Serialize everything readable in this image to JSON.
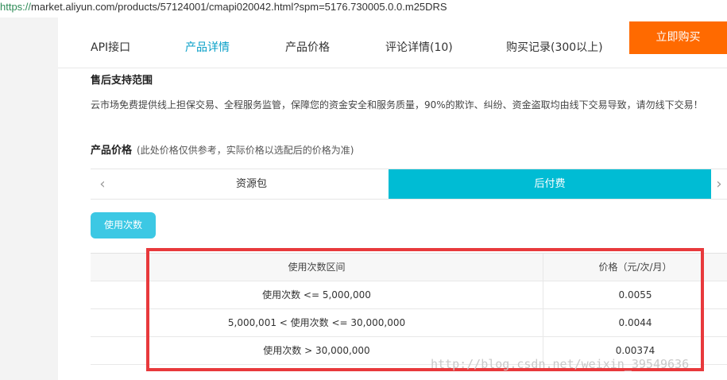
{
  "browser": {
    "url_scheme": "https://",
    "url_rest": "market.aliyun.com/products/57124001/cmapi020042.html?spm=5176.730005.0.0.m25DRS"
  },
  "nav": {
    "tabs": [
      {
        "label": "API接口",
        "active": false
      },
      {
        "label": "产品详情",
        "active": true
      },
      {
        "label": "产品价格",
        "active": false
      },
      {
        "label": "评论详情(10)",
        "active": false
      },
      {
        "label": "购买记录(300以上)",
        "active": false
      }
    ],
    "buy_button": "立即购买"
  },
  "support": {
    "title": "售后支持范围",
    "text": "云市场免费提供线上担保交易、全程服务监管，保障您的资金安全和服务质量，90%的欺诈、纠纷、资金盗取均由线下交易导致，请勿线下交易！"
  },
  "pricing": {
    "title": "产品价格",
    "note": "(此处价格仅供参考，实际价格以选配后的价格为准)",
    "prev_arrow": "‹",
    "next_arrow": "›",
    "tabs": [
      {
        "label": "资源包",
        "active": false
      },
      {
        "label": "后付费",
        "active": true
      }
    ],
    "spec_pill": "使用次数",
    "table": {
      "headers": [
        "使用次数区间",
        "价格（元/次/月）"
      ],
      "rows": [
        [
          "使用次数 <= 5,000,000",
          "0.0055"
        ],
        [
          "5,000,001 < 使用次数 <= 30,000,000",
          "0.0044"
        ],
        [
          "使用次数 > 30,000,000",
          "0.00374"
        ]
      ]
    }
  },
  "watermark": "http://blog.csdn.net/weixin_39549636",
  "colors": {
    "accent": "#00bcd4",
    "buy": "#ff6a00",
    "highlight": "#e8393c",
    "active_tab_text": "#0aa0c8"
  }
}
